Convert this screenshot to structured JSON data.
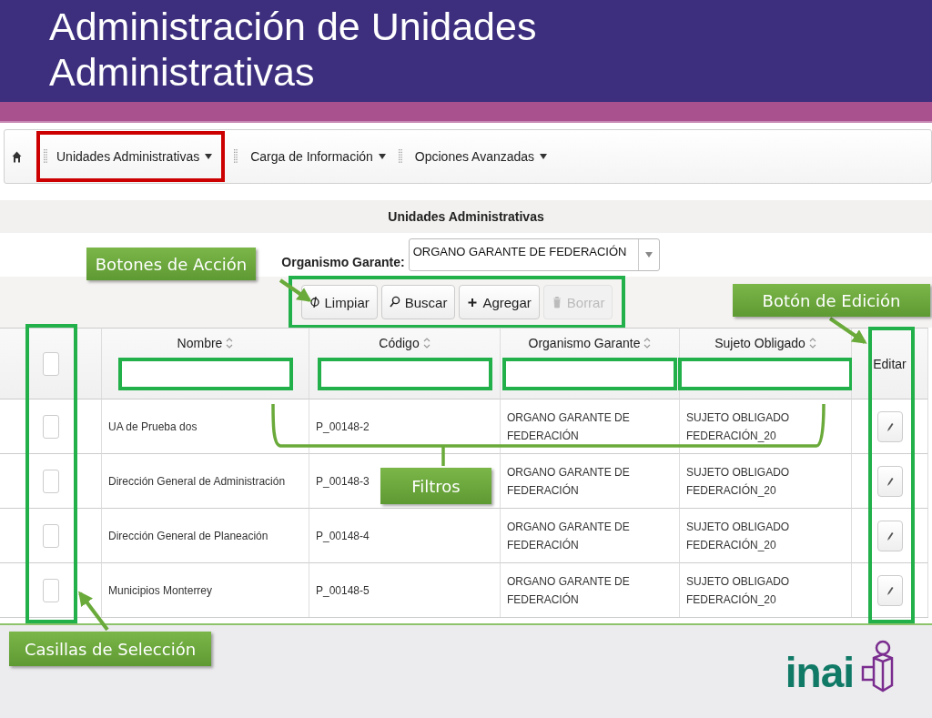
{
  "slide": {
    "title": "Administración de Unidades Administrativas"
  },
  "menu": {
    "items": [
      {
        "label": "Unidades Administrativas"
      },
      {
        "label": "Carga de Información"
      },
      {
        "label": "Opciones Avanzadas"
      }
    ]
  },
  "panel": {
    "title": "Unidades Administrativas",
    "filter_label": "Organismo Garante:",
    "filter_value": "ORGANO GARANTE DE FEDERACIÓN"
  },
  "actions": [
    {
      "label": "Limpiar",
      "kind": "clear",
      "disabled": false
    },
    {
      "label": "Buscar",
      "kind": "search",
      "disabled": false
    },
    {
      "label": "Agregar",
      "kind": "add",
      "disabled": false
    },
    {
      "label": "Borrar",
      "kind": "delete",
      "disabled": true
    }
  ],
  "table": {
    "select_all": {
      "checked": false
    },
    "columns": [
      "Nombre",
      "Código",
      "Organismo Garante",
      "Sujeto Obligado"
    ],
    "edit_column": "Editar",
    "rows": [
      {
        "checked": false,
        "cells": [
          "UA de Prueba dos",
          "P_00148-2",
          "ORGANO GARANTE DE FEDERACIÓN",
          "SUJETO OBLIGADO FEDERACIÓN_20"
        ]
      },
      {
        "checked": false,
        "cells": [
          "Dirección General de Administración",
          "P_00148-3",
          "ORGANO GARANTE DE FEDERACIÓN",
          "SUJETO OBLIGADO FEDERACIÓN_20"
        ]
      },
      {
        "checked": false,
        "cells": [
          "Dirección General de Planeación",
          "P_00148-4",
          "ORGANO GARANTE DE FEDERACIÓN",
          "SUJETO OBLIGADO FEDERACIÓN_20"
        ]
      },
      {
        "checked": false,
        "cells": [
          "Municipios Monterrey",
          "P_00148-5",
          "ORGANO GARANTE DE FEDERACIÓN",
          "SUJETO OBLIGADO FEDERACIÓN_20"
        ]
      }
    ]
  },
  "annotations": [
    {
      "text": "Botones de Acción"
    },
    {
      "text": "Botón de Edición"
    },
    {
      "text": "Filtros"
    },
    {
      "text": "Casillas de Selección"
    }
  ],
  "logo": {
    "text": "inai"
  }
}
